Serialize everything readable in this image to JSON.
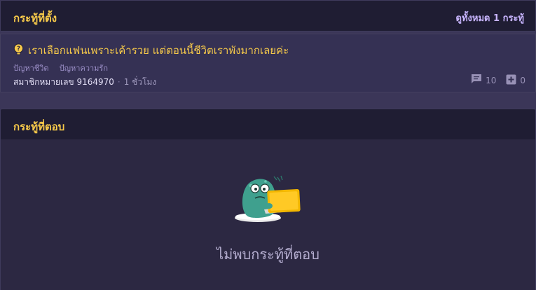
{
  "created_section": {
    "title": "กระทู้ที่ตั้ง",
    "view_all": "ดูทั้งหมด 1 กระทู้"
  },
  "topic": {
    "title": "เราเลือกแฟนเพราะเค้ารวย แต่ตอนนี้ชีวิตเราพังมากเลยค่ะ",
    "tags": [
      "ปัญหาชีวิต",
      "ปัญหาความรัก"
    ],
    "author": "สมาชิกหมายเลข 9164970",
    "separator": "·",
    "time": "1 ชั่วโมง",
    "comments": "10",
    "votes": "0"
  },
  "replied_section": {
    "title": "กระทู้ที่ตอบ",
    "empty_message": "ไม่พบกระทู้ที่ตอบ"
  },
  "colors": {
    "accent": "#f6c94a",
    "link": "#c8b5ff",
    "background": "#3b3658",
    "header": "#1f1d33",
    "card": "#353154",
    "empty_panel": "#2c2842"
  },
  "icons": [
    "question-bulb-icon",
    "comment-icon",
    "plus-box-icon",
    "mascot-laptop-illustration"
  ]
}
